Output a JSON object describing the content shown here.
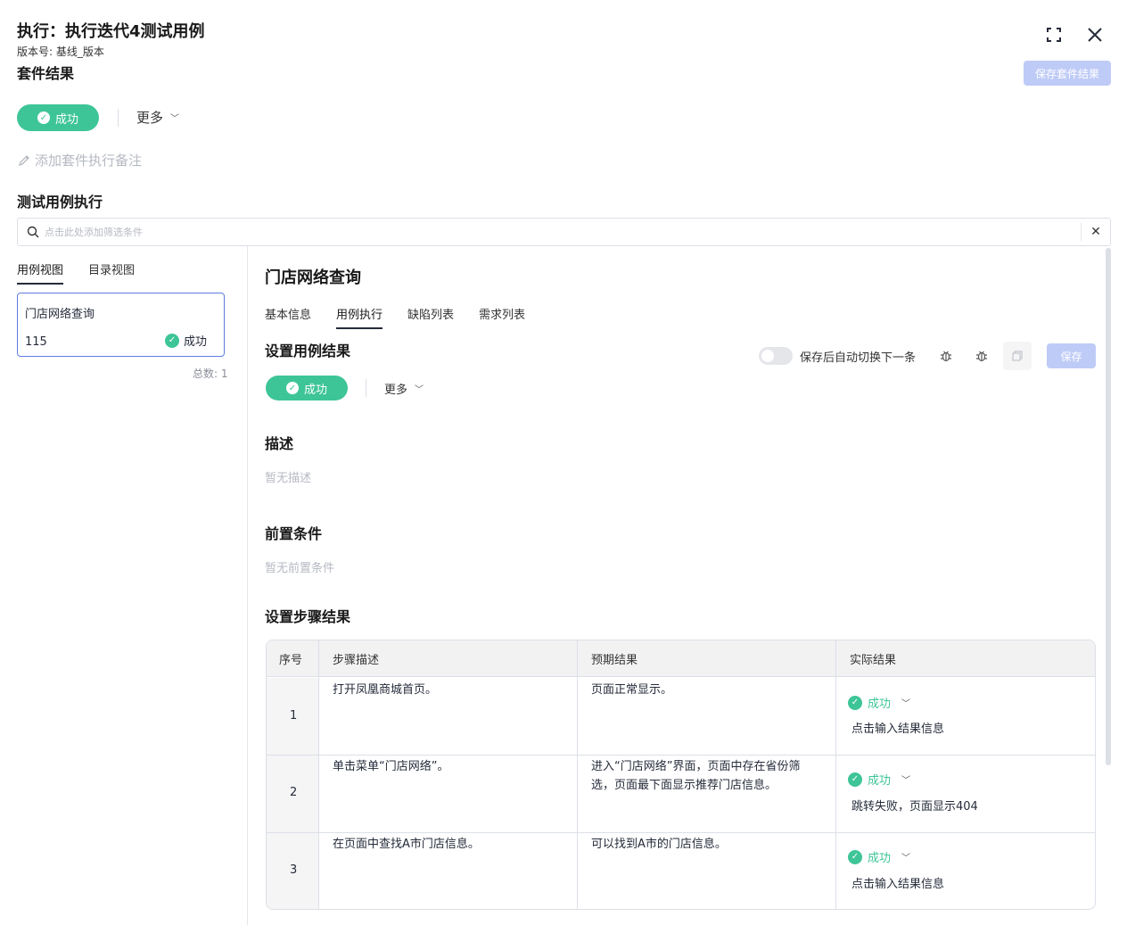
{
  "header": {
    "title": "执行：执行迭代4测试用例",
    "version": "版本号: 基线_版本",
    "suite_heading": "套件结果",
    "save_suite_label": "保存套件结果"
  },
  "suite": {
    "status_label": "成功",
    "more_label": "更多",
    "add_note_label": "添加套件执行备注"
  },
  "execution": {
    "heading": "测试用例执行",
    "filter_placeholder": "点击此处添加筛选条件"
  },
  "left": {
    "tabs": [
      "用例视图",
      "目录视图"
    ],
    "case": {
      "name": "门店网络查询",
      "id": "115",
      "status": "成功"
    },
    "total": "总数: 1"
  },
  "detail": {
    "title": "门店网络查询",
    "tabs": [
      "基本信息",
      "用例执行",
      "缺陷列表",
      "需求列表"
    ],
    "set_result_heading": "设置用例结果",
    "auto_switch_label": "保存后自动切换下一条",
    "save_label": "保存",
    "status_label": "成功",
    "more_label": "更多",
    "desc_heading": "描述",
    "desc_empty": "暂无描述",
    "pre_heading": "前置条件",
    "pre_empty": "暂无前置条件",
    "steps_heading": "设置步骤结果"
  },
  "steps_table": {
    "headers": [
      "序号",
      "步骤描述",
      "预期结果",
      "实际结果"
    ],
    "rows": [
      {
        "idx": "1",
        "step": "打开凤凰商城首页。",
        "expected": "页面正常显示。",
        "status": "成功",
        "actual": "点击输入结果信息"
      },
      {
        "idx": "2",
        "step": "单击菜单“门店网络”。",
        "expected_1": "进入“门店网络”界面，页面中存在省份筛",
        "expected_2": "选，页面最下面显示推荐门店信息。",
        "status": "成功",
        "actual": "跳转失败，页面显示404"
      },
      {
        "idx": "3",
        "step": "在页面中查找A市门店信息。",
        "expected": "可以找到A市的门店信息。",
        "status": "成功",
        "actual": "点击输入结果信息"
      }
    ]
  },
  "colors": {
    "success": "#3ec597",
    "primary_disabled": "#bfcbf7",
    "accent": "#5e7ce0"
  }
}
